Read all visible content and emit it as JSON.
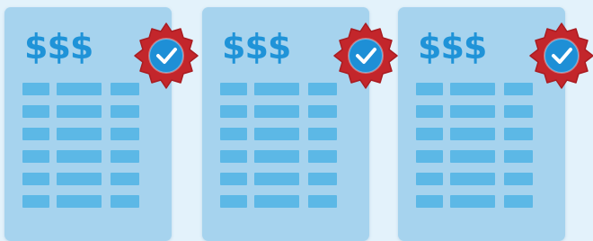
{
  "documents": [
    {
      "title": "$$$",
      "badge": "check-icon"
    },
    {
      "title": "$$$",
      "badge": "check-icon"
    },
    {
      "title": "$$$",
      "badge": "check-icon"
    }
  ],
  "colors": {
    "background": "#e3f2fb",
    "paper": "#a6d3ee",
    "accent": "#1f93d8",
    "table_cells": "#5cb8e6",
    "seal_outer": "#c3262b",
    "seal_inner": "#1e8fd6"
  }
}
